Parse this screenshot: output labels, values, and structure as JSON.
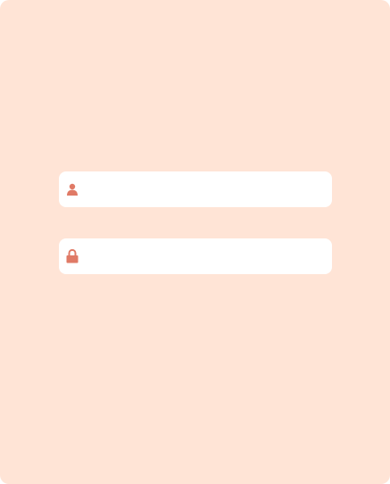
{
  "colors": {
    "background": "#ffe4d6",
    "field_background": "#ffffff",
    "icon_accent": "#e07a66"
  },
  "username_field": {
    "icon": "user-icon",
    "value": "",
    "placeholder": ""
  },
  "password_field": {
    "icon": "lock-icon",
    "value": "",
    "placeholder": ""
  }
}
